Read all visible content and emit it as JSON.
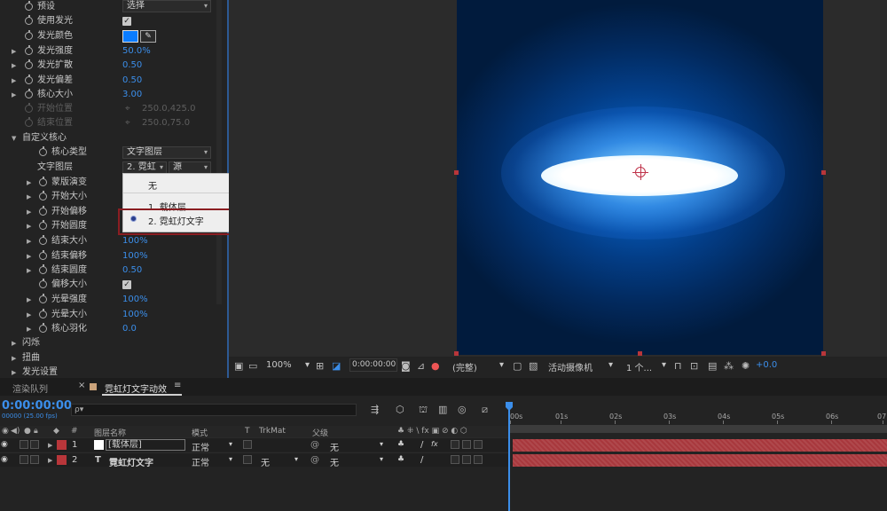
{
  "effects": {
    "rows": [
      {
        "label": "预设",
        "type": "dropdown",
        "value": "选择",
        "dim": false,
        "twirl": false
      },
      {
        "label": "使用发光",
        "type": "checkbox",
        "value": "✓",
        "dim": false,
        "twirl": false
      },
      {
        "label": "发光颜色",
        "type": "color",
        "value": "",
        "dim": false,
        "twirl": false
      },
      {
        "label": "发光强度",
        "type": "value",
        "value": "50.0%",
        "dim": false,
        "twirl": true
      },
      {
        "label": "发光扩散",
        "type": "value",
        "value": "0.50",
        "dim": false,
        "twirl": true
      },
      {
        "label": "发光偏差",
        "type": "value",
        "value": "0.50",
        "dim": false,
        "twirl": true
      },
      {
        "label": "核心大小",
        "type": "value",
        "value": "3.00",
        "dim": false,
        "twirl": true
      },
      {
        "label": "开始位置",
        "type": "point",
        "value": "250.0,425.0",
        "dim": true,
        "twirl": false
      },
      {
        "label": "结束位置",
        "type": "point",
        "value": "250.0,75.0",
        "dim": true,
        "twirl": false
      }
    ],
    "group_custom_core": "自定义核心",
    "core_type_label": "核心类型",
    "core_type_value": "文字图层",
    "text_layer_label": "文字图层",
    "text_layer_value": "2. 霓虹",
    "text_layer_source": "源",
    "sub_rows": [
      {
        "label": "蒙版演变",
        "value": ""
      },
      {
        "label": "开始大小",
        "value": ""
      },
      {
        "label": "开始偏移",
        "value": ""
      },
      {
        "label": "开始圆度",
        "value": ""
      },
      {
        "label": "结束大小",
        "value": "100%"
      },
      {
        "label": "结束偏移",
        "value": "100%"
      },
      {
        "label": "结束圆度",
        "value": "0.50"
      },
      {
        "label": "偏移大小",
        "value": "✓",
        "checkbox": true
      },
      {
        "label": "光晕强度",
        "value": "100%"
      },
      {
        "label": "光晕大小",
        "value": "100%"
      },
      {
        "label": "核心羽化",
        "value": "0.0"
      }
    ],
    "group_flicker": "闪烁",
    "group_distort": "扭曲",
    "group_glow_settings": "发光设置",
    "color_hex": "#0a7cff"
  },
  "popup": {
    "items": [
      "无",
      "1. 载体层",
      "2. 霓虹灯文字"
    ],
    "selected_index": 2
  },
  "viewer": {
    "zoom": "100%",
    "time": "0:00:00:00",
    "quality": "(完整)",
    "camera": "活动摄像机",
    "views": "1 个...",
    "exposure": "+0.0"
  },
  "timeline": {
    "tab_render_queue": "渲染队列",
    "tab_comp": "霓虹灯文字动效",
    "timecode": "0:00:00:00",
    "fps": "00000 (25.00 fps)",
    "search_placeholder": "ρ▾",
    "headers": {
      "num": "#",
      "name": "图层名称",
      "mode": "模式",
      "t": "T",
      "trkmat": "TrkMat",
      "parent": "父级"
    },
    "layers": [
      {
        "num": "1",
        "name": "[载体层]",
        "mode": "正常",
        "trkmat": "",
        "parent": "无",
        "type": "solid"
      },
      {
        "num": "2",
        "name": "霓虹灯文字",
        "mode": "正常",
        "trkmat": "无",
        "parent": "无",
        "type": "text"
      }
    ],
    "ticks": [
      "00s",
      "01s",
      "02s",
      "03s",
      "04s",
      "05s",
      "06s",
      "07"
    ]
  },
  "colors": {
    "accent": "#3b8eea",
    "label_red": "#b8363a",
    "bar": "#a8383d",
    "highlight_box": "#8b1d22"
  }
}
